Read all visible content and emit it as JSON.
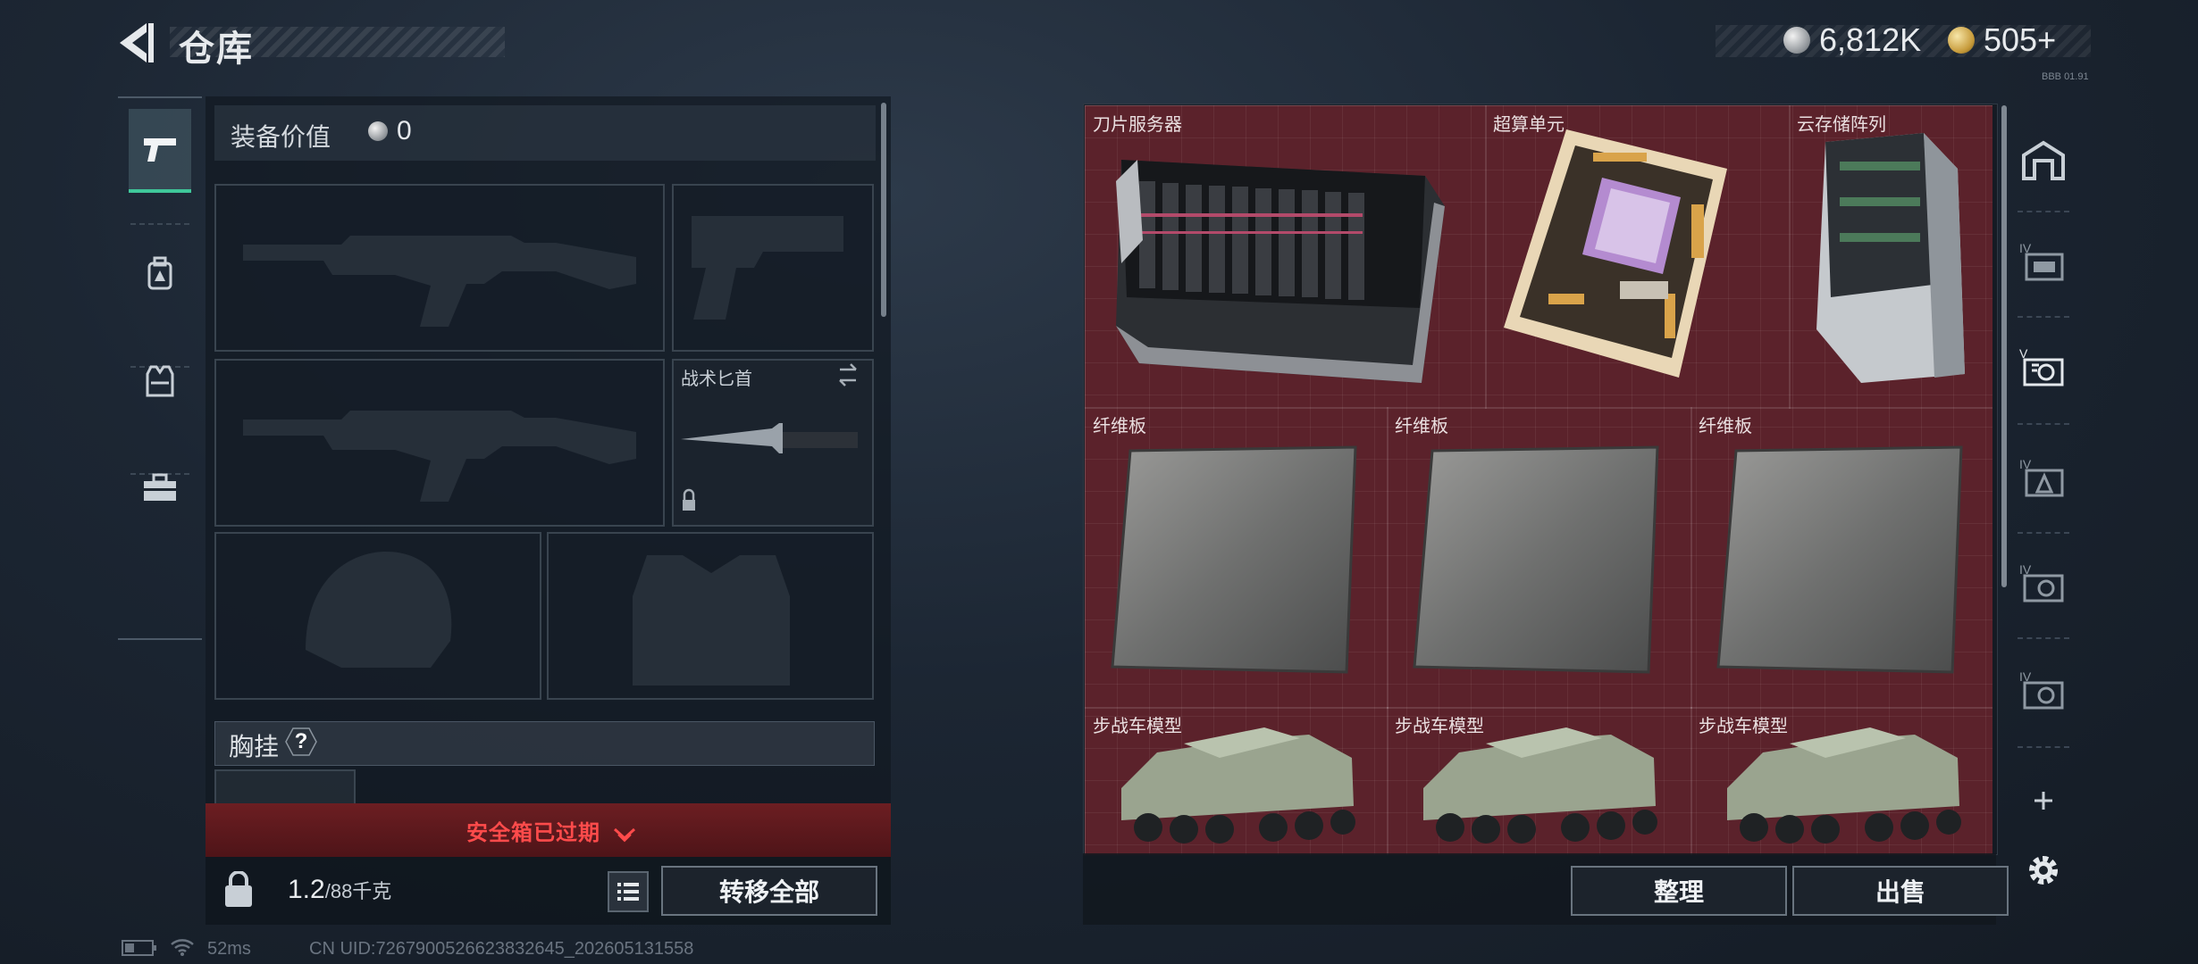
{
  "header": {
    "title": "仓库",
    "currency": [
      {
        "amount": "6,812K",
        "icon": "silver-coin-icon"
      },
      {
        "amount": "505+",
        "icon": "gold-coin-icon"
      }
    ],
    "currency_note": "BBB 01.91"
  },
  "categories": [
    {
      "name": "pistol-icon",
      "active": true
    },
    {
      "name": "backpack-icon",
      "active": false
    },
    {
      "name": "vest-icon",
      "active": false
    },
    {
      "name": "toolbox-icon",
      "active": false
    }
  ],
  "equipment": {
    "value_label": "装备价值",
    "value": "0",
    "knife_label": "战术匕首",
    "chest_rig_label": "胸挂",
    "chest_rig_help": "?",
    "safe_box_status": "安全箱已过期",
    "weight_current": "1.2",
    "weight_max": "/88千克",
    "transfer_all": "转移全部"
  },
  "storage": {
    "items": [
      {
        "label": "刀片服务器"
      },
      {
        "label": "超算单元"
      },
      {
        "label": "云存储阵列"
      },
      {
        "label": "纤维板"
      },
      {
        "label": "纤维板"
      },
      {
        "label": "纤维板"
      },
      {
        "label": "步战车模型"
      },
      {
        "label": "步战车模型"
      },
      {
        "label": "步战车模型"
      }
    ],
    "sort_label": "整理",
    "sell_label": "出售"
  },
  "right_tabs": [
    {
      "name": "storage-main-icon",
      "badge": ""
    },
    {
      "name": "storage-tab-folder-icon",
      "badge": "IV"
    },
    {
      "name": "storage-tab-gear-icon",
      "badge": "V"
    },
    {
      "name": "storage-tab-backpack-icon",
      "badge": "IV"
    },
    {
      "name": "storage-tab-gear-icon-2",
      "badge": "IV"
    },
    {
      "name": "storage-tab-gear-icon-3",
      "badge": "IV"
    }
  ],
  "footer": {
    "ping": "52ms",
    "uid": "CN UID:7267900526623832645_202605131558"
  },
  "colors": {
    "accent_green": "#3fc79a",
    "warning_red": "#ff4b4b",
    "storage_bg": "#5b222b"
  }
}
